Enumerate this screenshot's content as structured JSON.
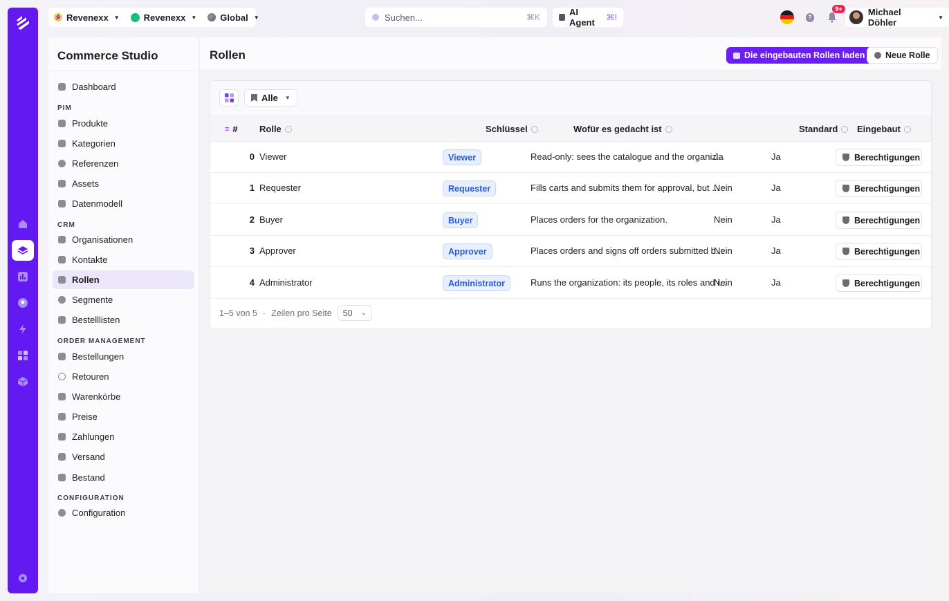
{
  "topbar": {
    "workspaces": [
      {
        "label": "Revenexx",
        "icon": "revenexx-logo-icon"
      },
      {
        "label": "Revenexx",
        "icon": "green-dot-icon"
      },
      {
        "label": "Global",
        "icon": "globe-icon"
      }
    ],
    "search": {
      "placeholder": "Suchen...",
      "shortcut": "⌘K"
    },
    "agent": {
      "label": "AI Agent",
      "shortcut": "⌘I"
    },
    "notifications_badge": "9+",
    "user_name": "Michael Döhler"
  },
  "sidebar": {
    "title": "Commerce Studio",
    "items": [
      {
        "label": "Dashboard"
      },
      {
        "section": "PIM"
      },
      {
        "label": "Produkte"
      },
      {
        "label": "Kategorien"
      },
      {
        "label": "Referenzen"
      },
      {
        "label": "Assets"
      },
      {
        "label": "Datenmodell"
      },
      {
        "section": "CRM"
      },
      {
        "label": "Organisationen"
      },
      {
        "label": "Kontakte"
      },
      {
        "label": "Rollen",
        "active": true
      },
      {
        "label": "Segmente"
      },
      {
        "label": "Bestelllisten"
      },
      {
        "section": "ORDER MANAGEMENT"
      },
      {
        "label": "Bestellungen"
      },
      {
        "label": "Retouren"
      },
      {
        "label": "Warenkörbe"
      },
      {
        "label": "Preise"
      },
      {
        "label": "Zahlungen"
      },
      {
        "label": "Versand"
      },
      {
        "label": "Bestand"
      },
      {
        "section": "CONFIGURATION"
      },
      {
        "label": "Configuration"
      }
    ]
  },
  "page": {
    "title": "Rollen",
    "load_builtin_label": "Die eingebauten Rollen laden",
    "new_role_label": "Neue Rolle",
    "filter_label": "Alle"
  },
  "table": {
    "headers": {
      "num": "#",
      "role": "Rolle",
      "key": "Schlüssel",
      "purpose": "Wofür es gedacht ist",
      "default": "Standard",
      "builtin": "Eingebaut"
    },
    "rows": [
      {
        "num": "0",
        "role": "Viewer",
        "key": "Viewer",
        "purpose": "Read-only: sees the catalogue and the organiz...",
        "default": "Ja",
        "builtin": "Ja",
        "action": "Berechtigungen"
      },
      {
        "num": "1",
        "role": "Requester",
        "key": "Requester",
        "purpose": "Fills carts and submits them for approval, but ...",
        "default": "Nein",
        "builtin": "Ja",
        "action": "Berechtigungen"
      },
      {
        "num": "2",
        "role": "Buyer",
        "key": "Buyer",
        "purpose": "Places orders for the organization.",
        "default": "Nein",
        "builtin": "Ja",
        "action": "Berechtigungen"
      },
      {
        "num": "3",
        "role": "Approver",
        "key": "Approver",
        "purpose": "Places orders and signs off orders submitted b...",
        "default": "Nein",
        "builtin": "Ja",
        "action": "Berechtigungen"
      },
      {
        "num": "4",
        "role": "Administrator",
        "key": "Administrator",
        "purpose": "Runs the organization: its people, its roles and i...",
        "default": "Nein",
        "builtin": "Ja",
        "action": "Berechtigungen"
      }
    ],
    "pagination": {
      "range": "1–5 von 5",
      "separator": "-",
      "rows_label": "Zeilen pro Seite",
      "rows_value": "50"
    }
  },
  "colors": {
    "accent": "#6a1ef0",
    "rail": "#6319f2",
    "tag_text": "#2a5bd7"
  }
}
